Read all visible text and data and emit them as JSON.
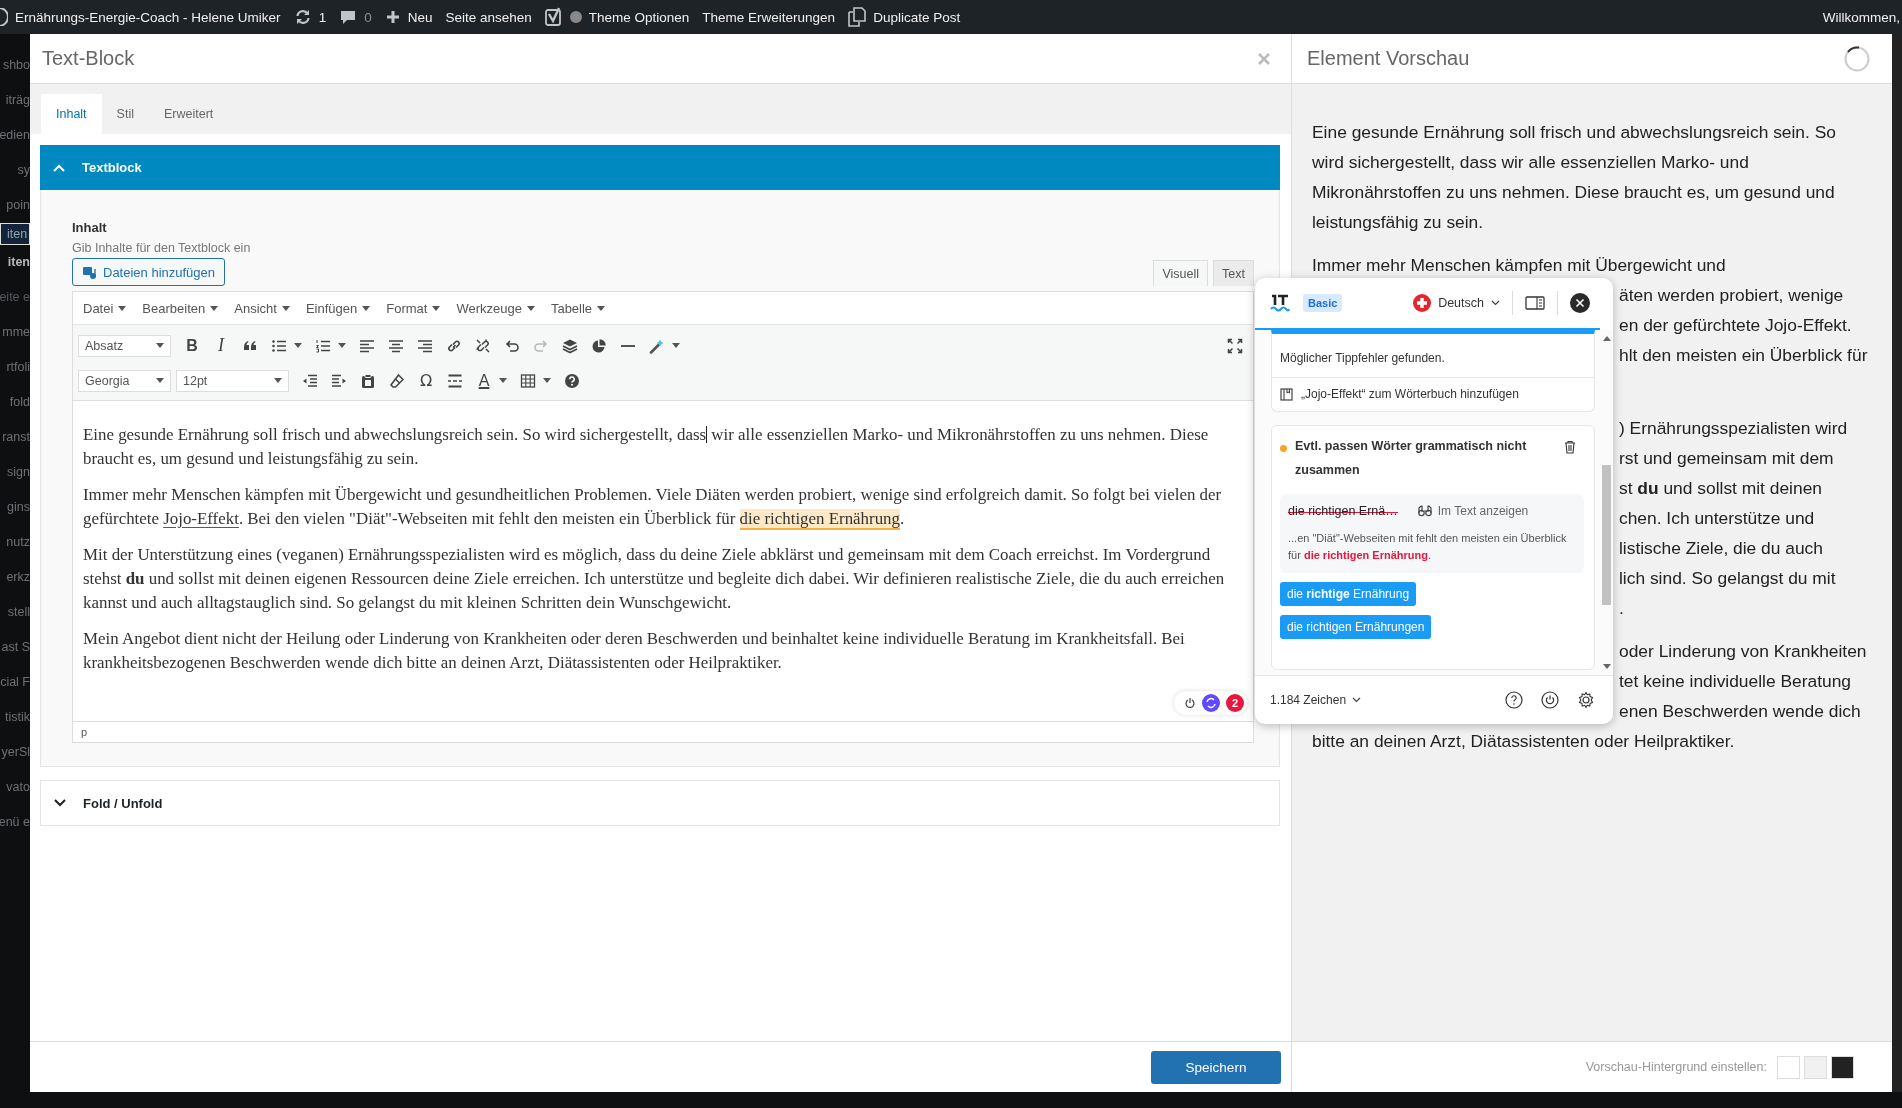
{
  "admin_bar": {
    "site": "Ernährungs-Energie-Coach - Helene Umiker",
    "updates": "1",
    "comments": "0",
    "new": "Neu",
    "view": "Seite ansehen",
    "links": [
      "Theme Optionen",
      "Theme Erweiterungen"
    ],
    "duplicate": "Duplicate Post",
    "greeting": "Willkommen,"
  },
  "sidebar": {
    "items": [
      {
        "label": "shbo",
        "kind": "menu",
        "selected": false
      },
      {
        "label": "iträg",
        "kind": "menu",
        "selected": false
      },
      {
        "label": "edien",
        "kind": "menu",
        "selected": false
      },
      {
        "label": "sy",
        "kind": "menu",
        "selected": false
      },
      {
        "label": "poin",
        "kind": "menu",
        "selected": false
      },
      {
        "label": "iten",
        "kind": "menu",
        "selected": true
      },
      {
        "label": "iten",
        "kind": "head",
        "selected": false
      },
      {
        "label": "eite e",
        "kind": "sub",
        "selected": false
      },
      {
        "label": "mme",
        "kind": "menu",
        "selected": false
      },
      {
        "label": "rtfoli",
        "kind": "menu",
        "selected": false
      },
      {
        "label": "fold",
        "kind": "menu",
        "selected": false
      },
      {
        "label": "ranst",
        "kind": "menu",
        "selected": false
      },
      {
        "label": "sign",
        "kind": "menu",
        "selected": false
      },
      {
        "label": "gins",
        "kind": "menu",
        "selected": false
      },
      {
        "label": "nutz",
        "kind": "menu",
        "selected": false
      },
      {
        "label": "erkz",
        "kind": "menu",
        "selected": false
      },
      {
        "label": "stell",
        "kind": "menu",
        "selected": false
      },
      {
        "label": "ast S",
        "kind": "menu",
        "selected": false
      },
      {
        "label": "cial F",
        "kind": "menu",
        "selected": false
      },
      {
        "label": "tistik",
        "kind": "menu",
        "selected": false
      },
      {
        "label": "yerSl",
        "kind": "menu",
        "selected": false
      },
      {
        "label": "vato",
        "kind": "menu",
        "selected": false
      },
      {
        "label": "enü e",
        "kind": "menu",
        "selected": false
      }
    ]
  },
  "modal": {
    "title": "Text-Block",
    "tabs": [
      {
        "label": "Inhalt",
        "selected": true
      },
      {
        "label": "Stil",
        "selected": false
      },
      {
        "label": "Erweitert",
        "selected": false
      }
    ],
    "section": {
      "title": "Textblock",
      "expanded": true
    },
    "field": {
      "label": "Inhalt",
      "hint": "Gib Inhalte für den Textblock ein",
      "media_button": "Dateien hinzufügen"
    },
    "editor_tabs": [
      {
        "label": "Visuell",
        "selected": true
      },
      {
        "label": "Text",
        "selected": false
      }
    ],
    "menu": [
      "Datei",
      "Bearbeiten",
      "Ansicht",
      "Einfügen",
      "Format",
      "Werkzeuge",
      "Tabelle"
    ],
    "toolbar": {
      "format_select": "Absatz",
      "bold_key": "B",
      "italic_key": "I",
      "redo_disabled": true,
      "font_select": "Georgia",
      "size_select": "12pt",
      "symbol_key": "Ω",
      "text_color_key": "A"
    },
    "content": [
      {
        "segments": [
          {
            "kind": "plain",
            "text": "Eine gesunde Ernährung soll frisch und abwechslungsreich sein. So wird sichergestellt, dass"
          },
          {
            "kind": "caret"
          },
          {
            "kind": "plain",
            "text": " wir alle essenziellen Marko- und Mikronährstoffen zu uns nehmen. Diese braucht es, um gesund und leistungsfähig zu sein."
          }
        ]
      },
      {
        "segments": [
          {
            "kind": "plain",
            "text": "Immer mehr Menschen kämpfen mit Übergewicht und gesundheitlichen Problemen. Viele Diäten werden probiert, wenige sind erfolgreich damit. So folgt bei vielen der gefürchtete "
          },
          {
            "kind": "spelling",
            "text": "Jojo-Effekt"
          },
          {
            "kind": "plain",
            "text": ". Bei den vielen \"Diät\"-Webseiten mit fehlt den meisten ein Überblick für "
          },
          {
            "kind": "grammar",
            "text": "die richtigen Ernährung"
          },
          {
            "kind": "plain",
            "text": "."
          }
        ]
      },
      {
        "segments": [
          {
            "kind": "plain",
            "text": "Mit der Unterstützung eines (veganen) Ernährungsspezialisten wird es möglich, dass du deine Ziele abklärst und gemeinsam mit dem Coach erreichst. Im Vordergrund stehst "
          },
          {
            "kind": "bold",
            "text": "du"
          },
          {
            "kind": "plain",
            "text": " und sollst mit deinen eigenen Ressourcen deine Ziele erreichen. Ich unterstütze und begleite dich dabei. Wir definieren realistische Ziele, die du auch erreichen kannst und auch alltagstauglich sind. So gelangst du mit kleinen Schritten dein Wunschgewicht."
          }
        ]
      },
      {
        "segments": [
          {
            "kind": "plain",
            "text": "Mein Angebot dient nicht der Heilung oder Linderung von Krankheiten oder deren Beschwerden und beinhaltet keine individuelle Beratung im Krankheitsfall. Bei krankheitsbezogenen Beschwerden wende dich bitte an deinen Arzt, Diätassistenten oder Heilpraktiker."
          }
        ]
      }
    ],
    "path": "p",
    "lt_badge": {
      "count": "2"
    },
    "second_section": {
      "title": "Fold / Unfold",
      "expanded": false
    },
    "save": "Speichern"
  },
  "preview": {
    "title": "Element Vorschau",
    "paragraphs": [
      {
        "lines": [
          "Eine gesunde Ernährung soll frisch und abwechslungsreich sein. So",
          "wird sichergestellt, dass wir alle essenziellen Marko- und",
          "Mikronährstoffen zu uns nehmen. Diese braucht es, um gesund und",
          "leistungsfähig zu sein."
        ]
      },
      {
        "lines": [
          "Immer mehr Menschen kämpfen mit Übergewicht und",
          "äten werden probiert, wenige",
          "en der gefürchtete Jojo-Effekt.",
          "hlt den meisten ein Überblick für"
        ]
      },
      {
        "lines": [
          ") Ernährungsspezialisten wird",
          "rst und gemeinsam mit dem",
          "st **du** und sollst mit deinen",
          "chen. Ich unterstütze und",
          "listische Ziele, die du auch",
          "lich sind. So gelangst du mit",
          "."
        ]
      },
      {
        "lines": [
          "oder Linderung von Krankheiten",
          "tet keine individuelle Beratung",
          "enen Beschwerden wende dich",
          "bitte an deinen Arzt, Diätassistenten oder Heilpraktiker."
        ]
      }
    ],
    "background_label": "Vorschau-Hintergrund einstellen:",
    "swatches": [
      {
        "color": "#ffffff"
      },
      {
        "color": "#f1f1f1"
      },
      {
        "color": "#222222"
      }
    ]
  },
  "lt_popup": {
    "plan": "Basic",
    "language": "Deutsch",
    "spelling_card": {
      "message": "Möglicher Tippfehler gefunden.",
      "action": "„Jojo-Effekt“ zum Wörterbuch hinzufügen"
    },
    "grammar_card": {
      "color": "#f5a623",
      "title": "Evtl. passen Wörter grammatisch nicht zusammen",
      "original": "die richtigen Ernä…",
      "show_in_text": "Im Text anzeigen",
      "context": "...en \"Diät\"-Webseiten mit fehlt den meisten ein Überblick für **die richtigen Ernährung**.",
      "suggestions": [
        "die **richtige** Ernährung",
        "die richtigen Ernährungen"
      ]
    },
    "char_count": "1.184 Zeichen"
  }
}
